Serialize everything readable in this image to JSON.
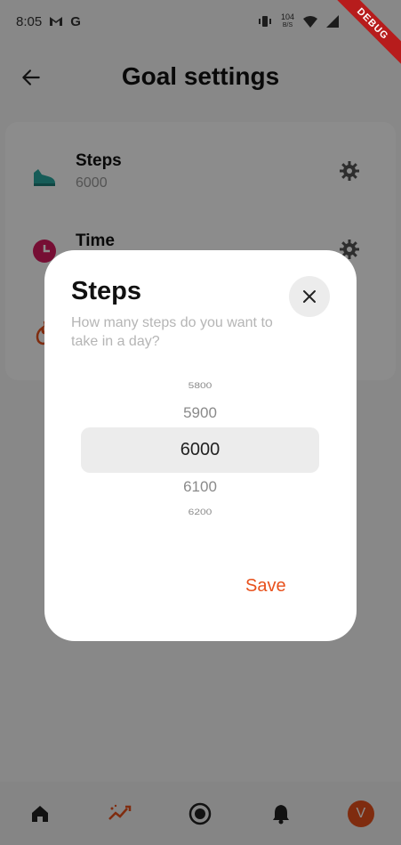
{
  "status_bar": {
    "time": "8:05",
    "gmail_icon": "gmail-icon",
    "g_label": "G",
    "speed_value": "104",
    "speed_unit": "B/S",
    "debug_label": "DEBUG"
  },
  "header": {
    "title": "Goal settings",
    "back_icon": "arrow-left-icon"
  },
  "goals": [
    {
      "title": "Steps",
      "value": "6000",
      "icon": "shoe-icon",
      "color": "#2aa8a0"
    },
    {
      "title": "Time",
      "value": "",
      "icon": "clock-icon",
      "color": "#d81b60"
    },
    {
      "title": "",
      "value": "",
      "icon": "flame-icon",
      "color": "#e8511c"
    }
  ],
  "dialog": {
    "title": "Steps",
    "subtitle": "How many steps do you want to take in a day?",
    "close_icon": "close-icon",
    "picker": {
      "items": [
        "5800",
        "5900",
        "6000",
        "6100",
        "6200"
      ],
      "selected": "6000"
    },
    "save_label": "Save"
  },
  "bottom_nav": {
    "items": [
      "home-icon",
      "activity-icon",
      "record-icon",
      "bell-icon",
      "avatar"
    ],
    "avatar_initial": "V",
    "accent": "#e8511c"
  }
}
